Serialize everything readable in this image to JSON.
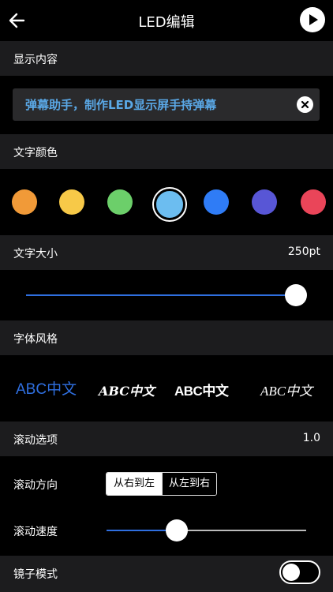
{
  "header": {
    "title": "LED编辑"
  },
  "display_content": {
    "label": "显示内容",
    "text_value": "弹幕助手，制作LED显示屏手持弹幕"
  },
  "text_color": {
    "label": "文字颜色",
    "swatches": [
      "#f19a38",
      "#f7c948",
      "#6ccf6a",
      "#6cbdf0",
      "#2f7cf6",
      "#5856d6",
      "#ea4559"
    ],
    "selected_index": 3
  },
  "text_size": {
    "label": "文字大小",
    "value": "250pt",
    "slider_fraction": 1.0
  },
  "font_style": {
    "label": "字体风格",
    "options": [
      "ABC中文",
      "ABC中文",
      "ABC中文",
      "ABC中文"
    ],
    "selected_index": 0
  },
  "scroll_options": {
    "label": "滚动选项",
    "value": "1.0",
    "direction_label": "滚动方向",
    "directions": [
      "从右到左",
      "从左到右"
    ],
    "selected_direction": 0,
    "speed_label": "滚动速度",
    "speed_fraction": 0.35
  },
  "mirror_mode": {
    "label": "镜子模式",
    "enabled": false
  },
  "colors": {
    "accent": "#2f6fe0",
    "link_text": "#5aa8e6",
    "section_bg": "#1c1c1e"
  }
}
